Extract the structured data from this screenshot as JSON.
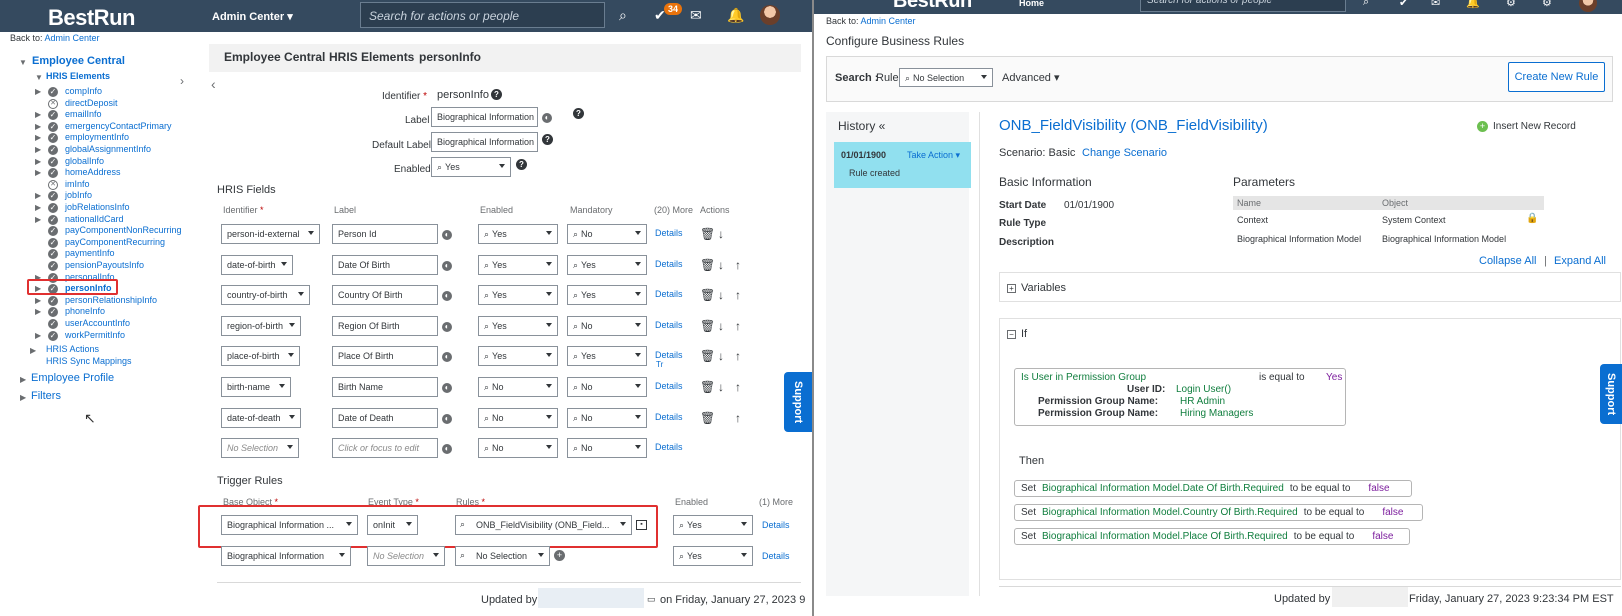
{
  "left": {
    "shell": {
      "logo_main": "BestRun",
      "admin_center": "Admin Center",
      "search_placeholder": "Search for actions or people",
      "badge_count": "34"
    },
    "back_text": "Back to:",
    "back_link": "Admin Center",
    "tree": {
      "root": "Employee Central",
      "hris_elements": "HRIS Elements",
      "items": [
        {
          "label": "compInfo",
          "icon": "check"
        },
        {
          "label": "directDeposit",
          "icon": "x"
        },
        {
          "label": "emailInfo",
          "icon": "check"
        },
        {
          "label": "emergencyContactPrimary",
          "icon": "check"
        },
        {
          "label": "employmentInfo",
          "icon": "check"
        },
        {
          "label": "globalAssignmentInfo",
          "icon": "check"
        },
        {
          "label": "globalInfo",
          "icon": "check"
        },
        {
          "label": "homeAddress",
          "icon": "check"
        },
        {
          "label": "imInfo",
          "icon": "x"
        },
        {
          "label": "jobInfo",
          "icon": "check"
        },
        {
          "label": "jobRelationsInfo",
          "icon": "check"
        },
        {
          "label": "nationalIdCard",
          "icon": "check"
        },
        {
          "label": "payComponentNonRecurring",
          "icon": "check"
        },
        {
          "label": "payComponentRecurring",
          "icon": "check"
        },
        {
          "label": "paymentInfo",
          "icon": "check"
        },
        {
          "label": "pensionPayoutsInfo",
          "icon": "check"
        },
        {
          "label": "personalInfo",
          "icon": "check"
        },
        {
          "label": "personInfo",
          "icon": "check"
        },
        {
          "label": "personRelationshipInfo",
          "icon": "check"
        },
        {
          "label": "phoneInfo",
          "icon": "check"
        },
        {
          "label": "userAccountInfo",
          "icon": "check"
        },
        {
          "label": "workPermitInfo",
          "icon": "check"
        }
      ],
      "hris_actions": "HRIS Actions",
      "hris_sync": "HRIS Sync Mappings",
      "employee_profile": "Employee Profile",
      "filters": "Filters"
    },
    "breadcrumb": [
      "Employee Central",
      "HRIS Elements",
      "personInfo"
    ],
    "identifier_label": "Identifier",
    "identifier_value": "personInfo",
    "label_label": "Label",
    "label_value": "Biographical Information",
    "default_label_label": "Default Label",
    "default_label_value": "Biographical Information",
    "enabled_label": "Enabled",
    "enabled_value": "Yes",
    "hris_fields_title": "HRIS Fields",
    "columns": {
      "identifier": "Identifier",
      "label": "Label",
      "enabled": "Enabled",
      "mandatory": "Mandatory",
      "more": "(20) More",
      "actions": "Actions"
    },
    "fields": [
      {
        "id": "person-id-external",
        "label": "Person Id",
        "enabled": "Yes",
        "mandatory": "No",
        "details": "Details"
      },
      {
        "id": "date-of-birth",
        "label": "Date Of Birth",
        "enabled": "Yes",
        "mandatory": "Yes",
        "details": "Details"
      },
      {
        "id": "country-of-birth",
        "label": "Country Of Birth",
        "enabled": "Yes",
        "mandatory": "Yes",
        "details": "Details"
      },
      {
        "id": "region-of-birth",
        "label": "Region Of Birth",
        "enabled": "Yes",
        "mandatory": "No",
        "details": "Details"
      },
      {
        "id": "place-of-birth",
        "label": "Place Of Birth",
        "enabled": "Yes",
        "mandatory": "Yes",
        "details": "Details"
      },
      {
        "id": "birth-name",
        "label": "Birth Name",
        "enabled": "No",
        "mandatory": "No",
        "details": "Details"
      },
      {
        "id": "date-of-death",
        "label": "Date of Death",
        "enabled": "No",
        "mandatory": "No",
        "details": "Details"
      },
      {
        "id": "No Selection",
        "label": "Click or focus to edit",
        "enabled": "No",
        "mandatory": "No",
        "details": "Details"
      }
    ],
    "tr_mark": "Tr",
    "trigger_title": "Trigger Rules",
    "trigger_columns": {
      "base": "Base Object",
      "event": "Event Type",
      "rules": "Rules",
      "enabled": "Enabled",
      "more": "(1) More"
    },
    "triggers": [
      {
        "base": "Biographical Information ...",
        "event": "onInit",
        "rule": "ONB_FieldVisibility (ONB_Field...",
        "enabled": "Yes",
        "details": "Details"
      },
      {
        "base": "Biographical Information",
        "event": "No Selection",
        "rule": "No Selection",
        "enabled": "Yes",
        "details": "Details"
      }
    ],
    "updated_by": "Updated by",
    "updated_on": "on Friday, January 27, 2023 9",
    "support": "Support"
  },
  "right": {
    "shell": {
      "logo_main": "BestRun",
      "home": "Home",
      "search_placeholder": "Search for actions or people"
    },
    "back_text": "Back to:",
    "back_link": "Admin Center",
    "page_title": "Configure Business Rules",
    "search_label": "Search :",
    "rule_label": "Rule",
    "search_value": "No Selection",
    "advanced": "Advanced",
    "create_btn": "Create New Rule",
    "history_title": "History «",
    "history_date": "01/01/1900",
    "take_action": "Take Action",
    "rule_created": "Rule created",
    "rule_title": "ONB_FieldVisibility (ONB_FieldVisibility)",
    "insert_record": "Insert New Record",
    "scenario_label": "Scenario: Basic",
    "change_scenario": "Change Scenario",
    "basic_info_title": "Basic Information",
    "start_date_label": "Start Date",
    "start_date_value": "01/01/1900",
    "rule_type_label": "Rule Type",
    "description_label": "Description",
    "parameters_title": "Parameters",
    "param_headers": [
      "Name",
      "Object"
    ],
    "params": [
      {
        "name": "Context",
        "object": "System Context"
      },
      {
        "name": "Biographical Information Model",
        "object": "Biographical Information Model"
      }
    ],
    "collapse_all": "Collapse All",
    "expand_all": "Expand All",
    "variables": "Variables",
    "if_label": "If",
    "condition": {
      "lhs": "Is User in Permission Group",
      "op": "is equal to",
      "rhs": "Yes",
      "user_id_label": "User ID:",
      "user_id_value": "Login User()",
      "pg1_label": "Permission Group Name:",
      "pg1_value": "HR Admin",
      "pg2_label": "Permission Group Name:",
      "pg2_value": "Hiring Managers"
    },
    "then_label": "Then",
    "actions": [
      {
        "set": "Set",
        "target": "Biographical Information Model.Date Of Birth.Required",
        "op": "to be equal to",
        "value": "false"
      },
      {
        "set": "Set",
        "target": "Biographical Information Model.Country Of Birth.Required",
        "op": "to be equal to",
        "value": "false"
      },
      {
        "set": "Set",
        "target": "Biographical Information Model.Place Of Birth.Required",
        "op": "to be equal to",
        "value": "false"
      }
    ],
    "updated_by": "Updated by",
    "updated_on": "Friday, January 27, 2023 9:23:34 PM EST",
    "support": "Support"
  }
}
